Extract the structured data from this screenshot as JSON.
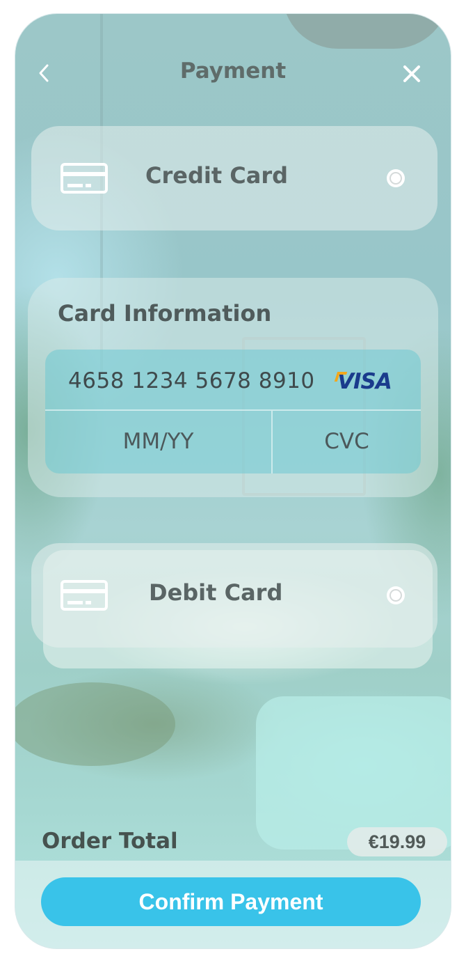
{
  "header": {
    "title": "Payment",
    "back_icon": "chevron-left-icon",
    "close_icon": "close-icon"
  },
  "payment_options": [
    {
      "label": "Credit Card",
      "icon": "credit-card-icon",
      "selected": false
    },
    {
      "label": "Debit Card",
      "icon": "credit-card-icon",
      "selected": false
    }
  ],
  "card_information": {
    "title": "Card Information",
    "card_number": "4658 1234 5678 8910",
    "card_brand": "VISA",
    "expiry_placeholder": "MM/YY",
    "cvc_placeholder": "CVC"
  },
  "order": {
    "label": "Order Total",
    "amount": "€19.99"
  },
  "confirm_button": {
    "label": "Confirm Payment"
  },
  "colors": {
    "accent": "#39c3e9",
    "visa_blue": "#1a3b8c",
    "visa_gold": "#f2a81c"
  }
}
